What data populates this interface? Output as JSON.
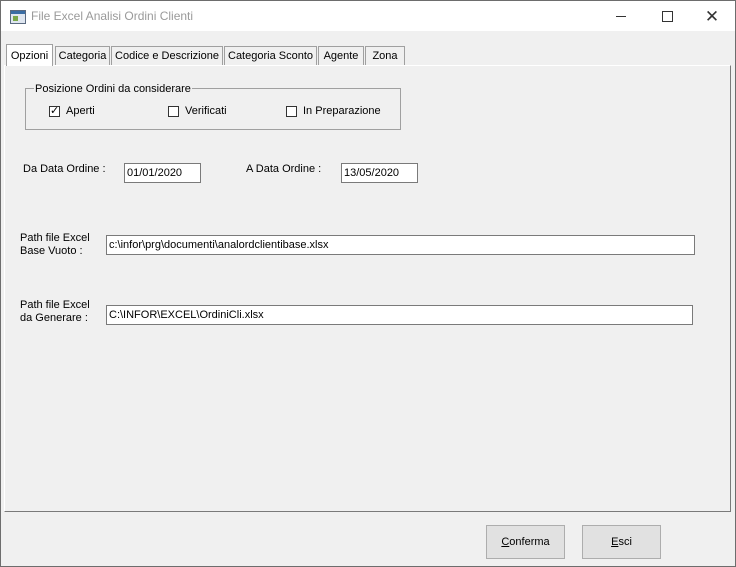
{
  "window": {
    "title": "File Excel Analisi Ordini Clienti",
    "min_glyph": "minimize-icon",
    "max_glyph": "maximize-icon",
    "close_glyph": "✕"
  },
  "tabs": [
    "Opzioni",
    "Categoria",
    "Codice e Descrizione",
    "Categoria Sconto",
    "Agente",
    "Zona"
  ],
  "options": {
    "group_title": "Posizione Ordini da considerare",
    "aperti": {
      "label": "Aperti",
      "checked": true
    },
    "verificati": {
      "label": "Verificati",
      "checked": false
    },
    "in_preparazione": {
      "label": "In Preparazione",
      "checked": false
    },
    "da_data_label": "Da Data Ordine :",
    "da_data_value": "01/01/2020",
    "a_data_label": "A Data Ordine :",
    "a_data_value": "13/05/2020",
    "path_base_label_1": "Path file Excel",
    "path_base_label_2": "Base Vuoto :",
    "path_base_value": "c:\\infor\\prg\\documenti\\analordclientibase.xlsx",
    "path_gen_label_1": "Path file Excel",
    "path_gen_label_2": "da Generare :",
    "path_gen_value": "C:\\INFOR\\EXCEL\\OrdiniCli.xlsx"
  },
  "buttons": {
    "conferma_first": "C",
    "conferma_rest": "onferma",
    "esci_first": "E",
    "esci_rest": "sci"
  }
}
